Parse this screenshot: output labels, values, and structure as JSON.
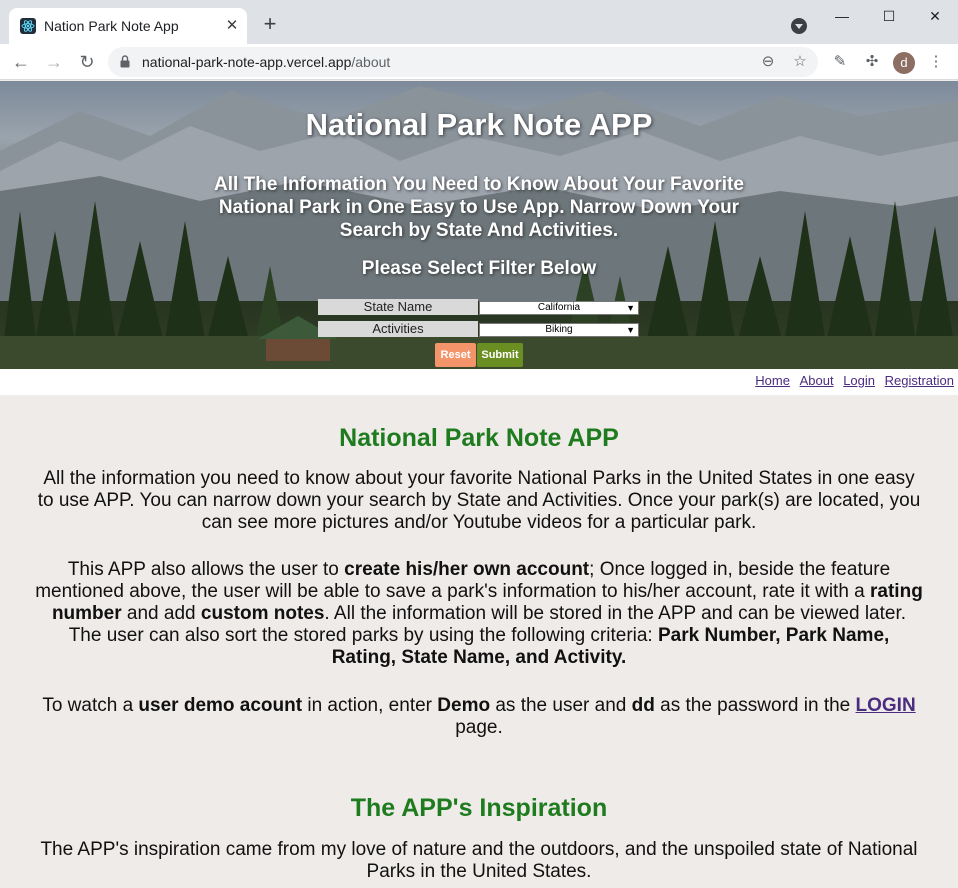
{
  "browser": {
    "tab_title": "Nation Park Note App",
    "url_domain": "national-park-note-app.vercel.app",
    "url_path": "/about",
    "avatar_letter": "d"
  },
  "hero": {
    "title": "National Park Note APP",
    "subtitle": "All The Information You Need to Know About Your Favorite National Park in One Easy to Use App. Narrow Down Your Search by State And Activities.",
    "filter_heading": "Please Select Filter Below",
    "state_label": "State Name",
    "state_value": "California",
    "activity_label": "Activities",
    "activity_value": "Biking",
    "reset_label": "Reset",
    "submit_label": "Submit"
  },
  "nav": {
    "home": "Home",
    "about": "About",
    "login": "Login",
    "registration": "Registration"
  },
  "about": {
    "heading": "National Park Note APP",
    "p1": "All the information you need to know about your favorite National Parks in the United States in one easy to use APP. You can narrow down your search by State and Activities. Once your park(s) are located, you can see more pictures and/or Youtube videos for a particular park.",
    "p2_a": "This APP also allows the user to ",
    "p2_b": "create his/her own account",
    "p2_c": "; Once logged in, beside the feature mentioned above, the user will be able to save a park's information to his/her account, rate it with a ",
    "p2_d": "rating number",
    "p2_e": " and add ",
    "p2_f": "custom notes",
    "p2_g": ". All the information will be stored in the APP and can be viewed later. The user can also sort the stored parks by using the following criteria: ",
    "p2_h": "Park Number, Park Name, Rating, State Name, and Activity.",
    "p3_a": "To watch a ",
    "p3_b": "user demo acount",
    "p3_c": " in action, enter ",
    "p3_d": "Demo",
    "p3_e": " as the user and ",
    "p3_f": "dd",
    "p3_g": " as the password in the ",
    "p3_link": "LOGIN",
    "p3_h": " page.",
    "heading2": "The APP's Inspiration",
    "p4": "The APP's inspiration came from my love of nature and the outdoors, and the unspoiled state of National Parks in the United States."
  },
  "colors": {
    "heading_green": "#1e7b1e",
    "link_purple": "#4b2c7f",
    "reset_orange": "#f4946b",
    "submit_olive": "#6b8e23",
    "page_bg": "#efebe9"
  }
}
